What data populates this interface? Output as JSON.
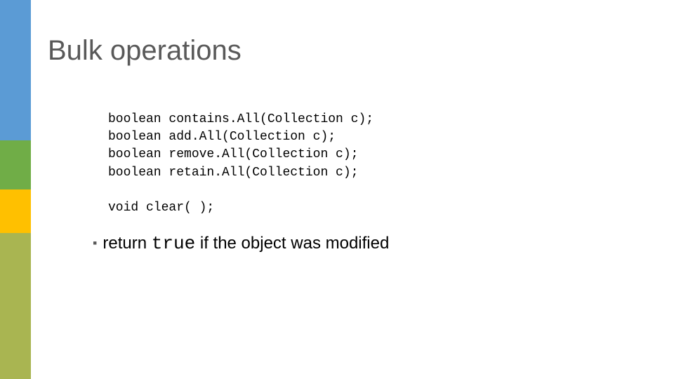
{
  "title": "Bulk operations",
  "code": {
    "line1": "boolean contains.All(Collection c);",
    "line2": "boolean add.All(Collection c);",
    "line3": "boolean remove.All(Collection c);",
    "line4": "boolean retain.All(Collection c);",
    "line5": "",
    "line6": "void clear( );"
  },
  "bullet": {
    "prefix": "return ",
    "keyword": "true",
    "suffix": " if the object was modified"
  },
  "colors": {
    "blue": "#5b9bd5",
    "green": "#70ad47",
    "yellow": "#ffc000",
    "olive": "#a9b551"
  }
}
